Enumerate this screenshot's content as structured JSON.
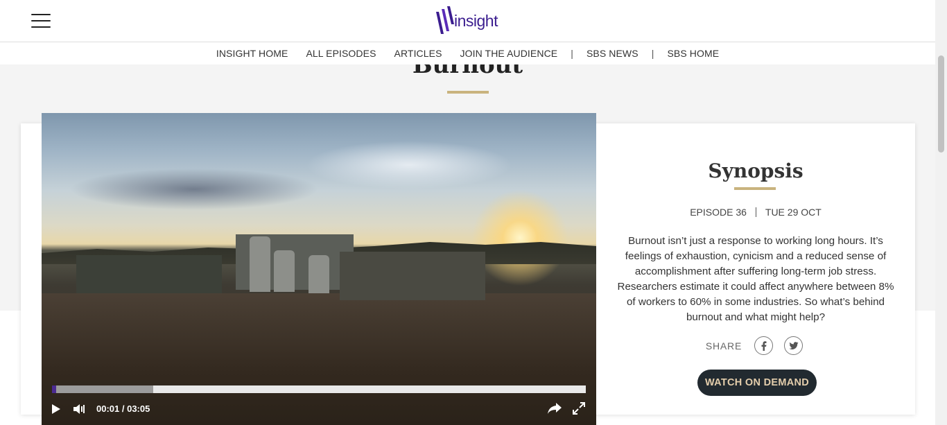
{
  "header": {
    "logo_text": "insight",
    "nav": [
      {
        "label": "INSIGHT HOME"
      },
      {
        "label": "ALL EPISODES"
      },
      {
        "label": "ARTICLES"
      },
      {
        "label": "JOIN THE AUDIENCE"
      },
      {
        "label": "SBS NEWS"
      },
      {
        "label": "SBS HOME"
      }
    ]
  },
  "page": {
    "title": "Burnout"
  },
  "video": {
    "time_display": "00:01 / 03:05",
    "played_fraction": 0.008,
    "buffered_fraction": 0.19
  },
  "synopsis": {
    "title": "Synopsis",
    "episode": "EPISODE 36",
    "date": "TUE 29 OCT",
    "body": "Burnout isn’t just a response to working long hours. It’s feelings of exhaustion, cynicism and a reduced sense of accomplishment after suffering long-term job stress. Researchers estimate it could affect anywhere between 8% of workers to 60% in some industries. So what’s behind burnout and what might help?",
    "share_label": "SHARE",
    "watch_label": "WATCH ON DEMAND"
  },
  "colors": {
    "brand": "#3b1d8f",
    "accent_gold": "#c9b37e",
    "button_bg": "#222a30",
    "button_text": "#e4ceac"
  }
}
